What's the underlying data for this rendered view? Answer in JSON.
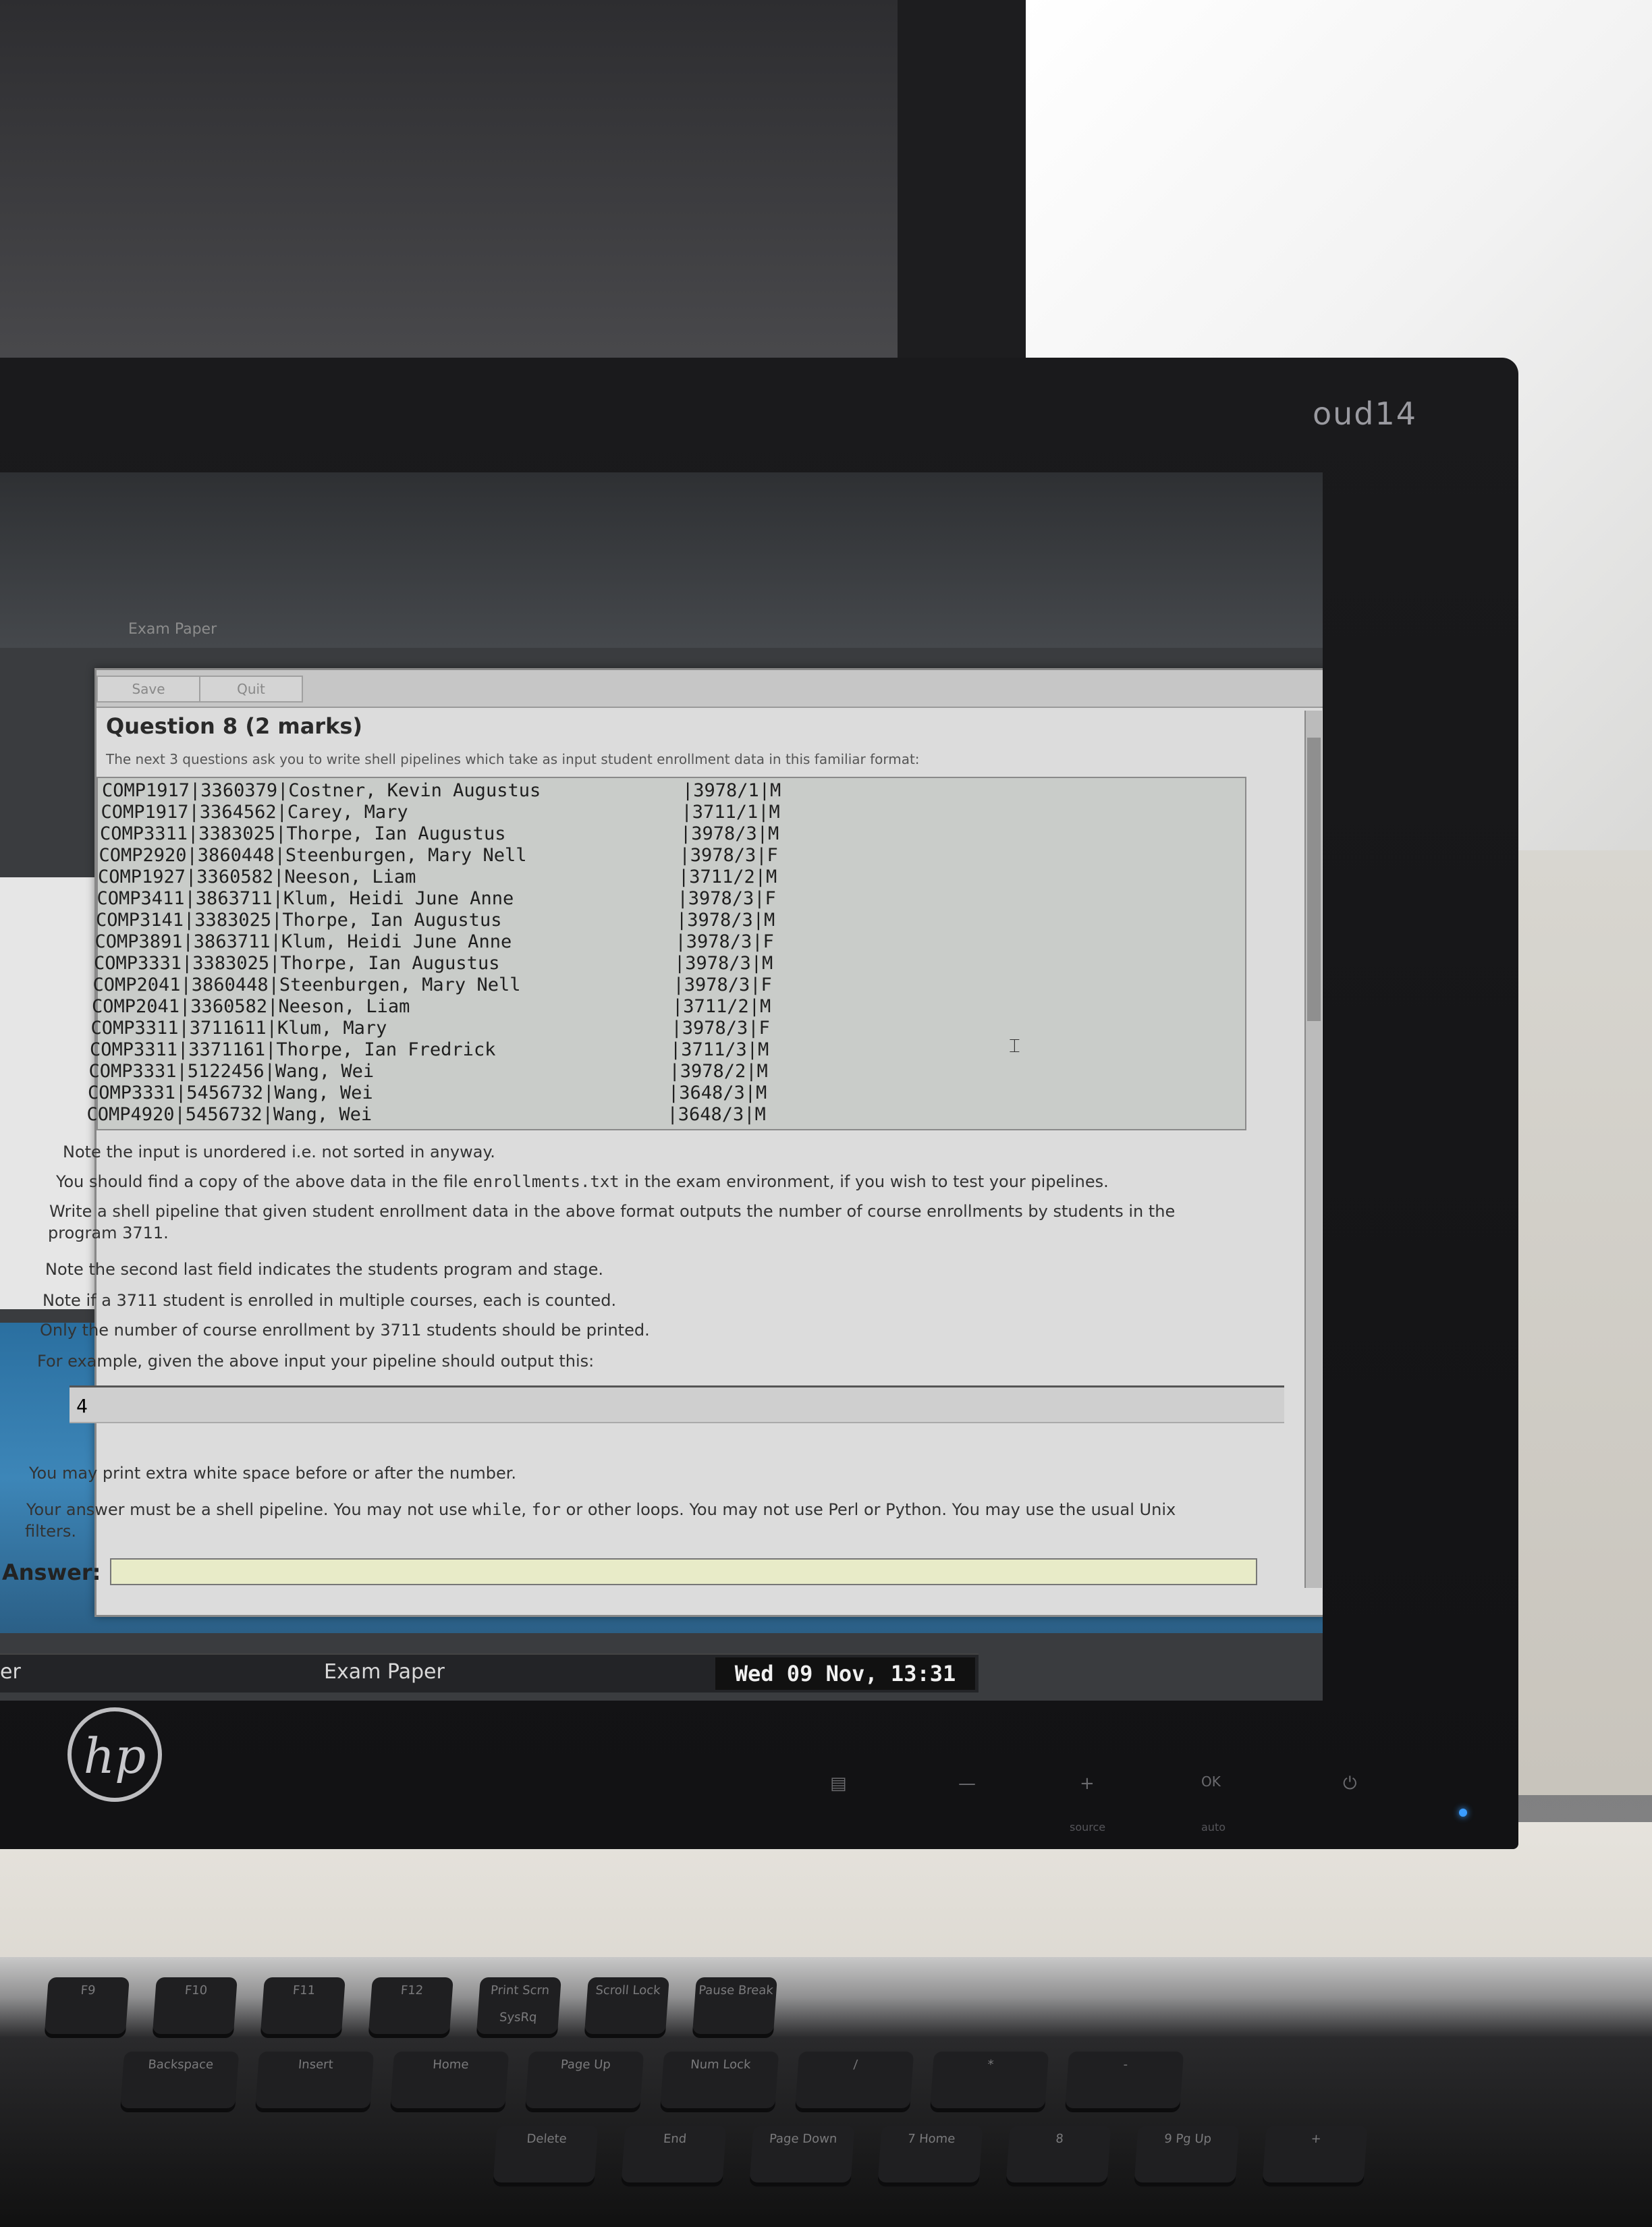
{
  "monitor": {
    "label": "oud14",
    "brand_logo": "hp"
  },
  "window": {
    "title": "Exam Paper",
    "toolbar": [
      "Save",
      "Quit"
    ]
  },
  "question": {
    "title": "Question 8 (2 marks)",
    "intro": "The next 3 questions ask you to write shell pipelines which take as input student enrollment data in this familiar format:",
    "rows": [
      {
        "course": "COMP1917",
        "id": "3360379",
        "name": "Costner, Kevin Augustus",
        "prog": "3978/1",
        "sex": "M"
      },
      {
        "course": "COMP1917",
        "id": "3364562",
        "name": "Carey, Mary",
        "prog": "3711/1",
        "sex": "M"
      },
      {
        "course": "COMP3311",
        "id": "3383025",
        "name": "Thorpe, Ian Augustus",
        "prog": "3978/3",
        "sex": "M"
      },
      {
        "course": "COMP2920",
        "id": "3860448",
        "name": "Steenburgen, Mary Nell",
        "prog": "3978/3",
        "sex": "F"
      },
      {
        "course": "COMP1927",
        "id": "3360582",
        "name": "Neeson, Liam",
        "prog": "3711/2",
        "sex": "M"
      },
      {
        "course": "COMP3411",
        "id": "3863711",
        "name": "Klum, Heidi June Anne",
        "prog": "3978/3",
        "sex": "F"
      },
      {
        "course": "COMP3141",
        "id": "3383025",
        "name": "Thorpe, Ian Augustus",
        "prog": "3978/3",
        "sex": "M"
      },
      {
        "course": "COMP3891",
        "id": "3863711",
        "name": "Klum, Heidi June Anne",
        "prog": "3978/3",
        "sex": "F"
      },
      {
        "course": "COMP3331",
        "id": "3383025",
        "name": "Thorpe, Ian Augustus",
        "prog": "3978/3",
        "sex": "M"
      },
      {
        "course": "COMP2041",
        "id": "3860448",
        "name": "Steenburgen, Mary Nell",
        "prog": "3978/3",
        "sex": "F"
      },
      {
        "course": "COMP2041",
        "id": "3360582",
        "name": "Neeson, Liam",
        "prog": "3711/2",
        "sex": "M"
      },
      {
        "course": "COMP3311",
        "id": "3711611",
        "name": "Klum, Mary",
        "prog": "3978/3",
        "sex": "F"
      },
      {
        "course": "COMP3311",
        "id": "3371161",
        "name": "Thorpe, Ian Fredrick",
        "prog": "3711/3",
        "sex": "M"
      },
      {
        "course": "COMP3331",
        "id": "5122456",
        "name": "Wang, Wei",
        "prog": "3978/2",
        "sex": "M"
      },
      {
        "course": "COMP3331",
        "id": "5456732",
        "name": "Wang, Wei",
        "prog": "3648/3",
        "sex": "M"
      },
      {
        "course": "COMP4920",
        "id": "5456732",
        "name": "Wang, Wei",
        "prog": "3648/3",
        "sex": "M"
      }
    ],
    "note_unordered": "Note the input is unordered i.e. not sorted in anyway.",
    "copy_note_pre": "You should find a copy of the above data in the file ",
    "copy_note_file": "enrollments.txt",
    "copy_note_post": " in the exam environment, if you wish to test your pipelines.",
    "task_line1": "Write a shell pipeline that given student enrollment data in the above format outputs the number of course enrollments by students in the",
    "task_line2": "program 3711.",
    "note_field": "Note the second last field indicates the students program and stage.",
    "note_multi": "Note if a 3711 student is enrolled in multiple courses, each is counted.",
    "note_only": "Only the number of course enrollment by 3711 students should be printed.",
    "example_intro": "For example, given the above input your pipeline should output this:",
    "example_output": "4",
    "whitespace_note": "You may print extra white space before or after the number.",
    "rules_pre": "Your answer must be a shell pipeline. You may not use ",
    "rules_while": "while",
    "rules_mid1": ", ",
    "rules_for": "for",
    "rules_mid2": " or other loops. You may not use Perl or Python.  You may use the usual Unix",
    "rules_line2": "filters.",
    "answer_label": "Answer:",
    "answer_value": ""
  },
  "taskbar": {
    "left_item": "er",
    "exam_item": "Exam Paper",
    "clock": "Wed 09 Nov, 13:31"
  },
  "bezel": {
    "buttons": [
      "—",
      "+",
      "OK"
    ],
    "sub_labels": [
      "source",
      "auto"
    ]
  },
  "keyboard": {
    "keys_row1": [
      "F9",
      "F10",
      "F11",
      "F12",
      "Print Scrn SysRq",
      "Scroll Lock",
      "Pause Break"
    ],
    "keys_row2": [
      "Backspace",
      "Insert",
      "Home",
      "Page Up",
      "Num Lock",
      "/",
      "*",
      "-"
    ],
    "keys_row3": [
      "Delete",
      "End",
      "Page Down",
      "7 Home",
      "8",
      "9 Pg Up",
      "+"
    ]
  }
}
